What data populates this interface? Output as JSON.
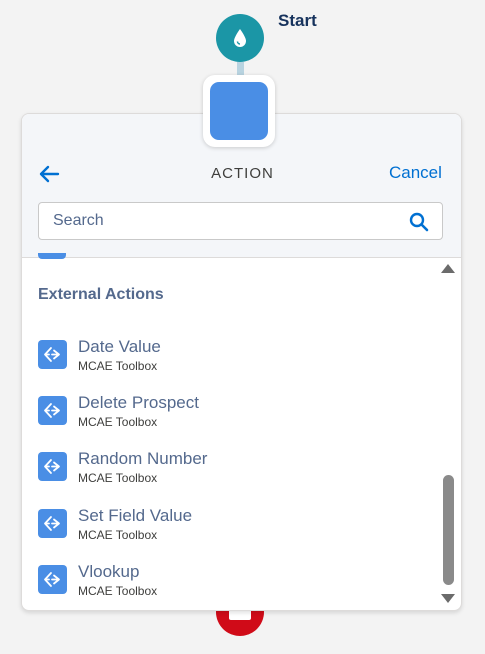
{
  "flow": {
    "start_label": "Start"
  },
  "panel": {
    "title": "ACTION",
    "cancel_label": "Cancel",
    "search": {
      "placeholder": "Search",
      "value": ""
    },
    "section_title": "External Actions",
    "items": [
      {
        "title": "Date Value",
        "subtitle": "MCAE Toolbox"
      },
      {
        "title": "Delete Prospect",
        "subtitle": "MCAE Toolbox"
      },
      {
        "title": "Random Number",
        "subtitle": "MCAE Toolbox"
      },
      {
        "title": "Set Field Value",
        "subtitle": "MCAE Toolbox"
      },
      {
        "title": "Vlookup",
        "subtitle": "MCAE Toolbox"
      }
    ]
  },
  "icons": {
    "start": "water-drop-icon",
    "back": "back-arrow-icon",
    "search": "search-icon",
    "item": "external-action-icon"
  },
  "colors": {
    "start_node": "#1b96a6",
    "action_node": "#4a8ee5",
    "end_node": "#d00b18",
    "link": "#0070d2",
    "section_text": "#54698d"
  }
}
